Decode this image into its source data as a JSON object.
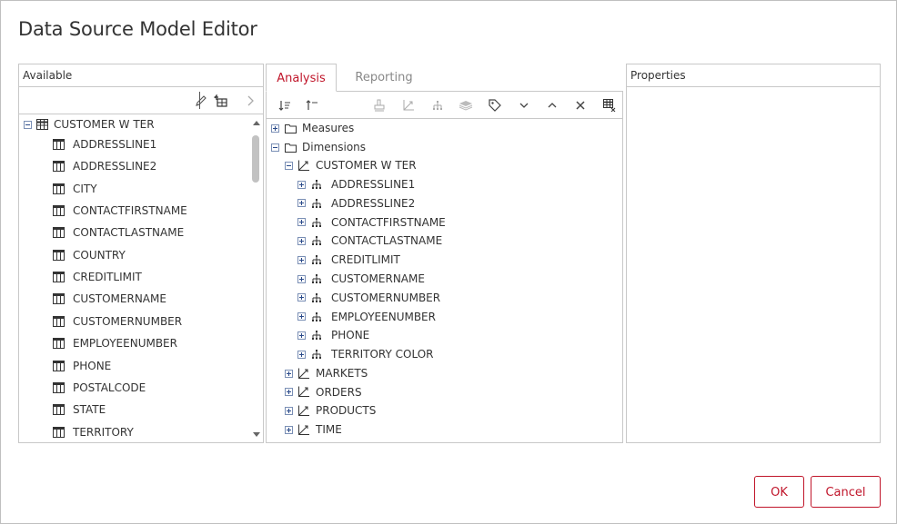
{
  "dialog": {
    "title": "Data Source Model Editor",
    "ok_label": "OK",
    "cancel_label": "Cancel",
    "accent_color": "#c0152a"
  },
  "available": {
    "header": "Available",
    "toolbar": [
      "edit-icon",
      "add-calculated-icon",
      "chevron-right-icon"
    ],
    "root": {
      "label": "CUSTOMER W TER",
      "icon": "table-icon",
      "expanded": true
    },
    "columns": [
      "ADDRESSLINE1",
      "ADDRESSLINE2",
      "CITY",
      "CONTACTFIRSTNAME",
      "CONTACTLASTNAME",
      "COUNTRY",
      "CREDITLIMIT",
      "CUSTOMERNAME",
      "CUSTOMERNUMBER",
      "EMPLOYEENUMBER",
      "PHONE",
      "POSTALCODE",
      "STATE",
      "TERRITORY"
    ]
  },
  "analysis": {
    "tabs": [
      {
        "label": "Analysis",
        "active": true
      },
      {
        "label": "Reporting",
        "active": false
      }
    ],
    "toolbar": [
      "sort-ascending-icon",
      "sort-descending-icon",
      "measure-icon",
      "dimension-icon",
      "hierarchy-icon",
      "level-icon",
      "tag-icon",
      "move-down-icon",
      "move-up-icon",
      "delete-icon",
      "table-settings-icon"
    ],
    "measures_label": "Measures",
    "dimensions_label": "Dimensions",
    "dimension_root": "CUSTOMER W TER",
    "hierarchies": [
      "ADDRESSLINE1",
      "ADDRESSLINE2",
      "CONTACTFIRSTNAME",
      "CONTACTLASTNAME",
      "CREDITLIMIT",
      "CUSTOMERNAME",
      "CUSTOMERNUMBER",
      "EMPLOYEENUMBER",
      "PHONE",
      "TERRITORY COLOR"
    ],
    "other_dimensions": [
      "MARKETS",
      "ORDERS",
      "PRODUCTS",
      "TIME"
    ]
  },
  "properties": {
    "header": "Properties"
  }
}
